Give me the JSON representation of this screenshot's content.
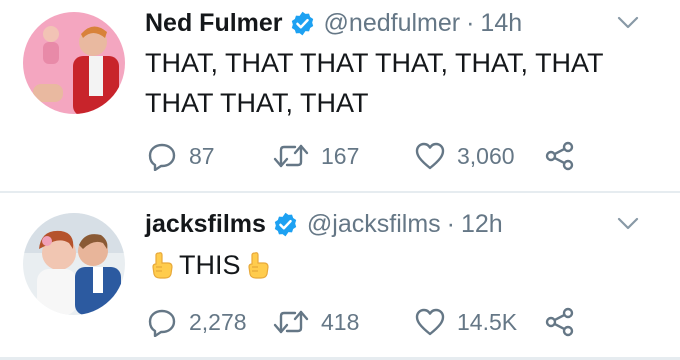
{
  "tweets": [
    {
      "display_name": "Ned Fulmer",
      "handle": "@nedfulmer",
      "separator": "·",
      "time": "14h",
      "text": "THAT, THAT THAT THAT, THAT, THAT THAT THAT, THAT",
      "replies": "87",
      "retweets": "167",
      "likes": "3,060"
    },
    {
      "display_name": "jacksfilms",
      "handle": "@jacksfilms",
      "separator": "·",
      "time": "12h",
      "text": "THIS",
      "text_emoji": "point-up-emoji",
      "replies": "2,278",
      "retweets": "418",
      "likes": "14.5K"
    }
  ],
  "colors": {
    "text": "#14171a",
    "secondary": "#657786",
    "verified": "#1da1f2",
    "divider": "#e6ecf0"
  },
  "icons": [
    "verified-badge-icon",
    "chevron-down-icon",
    "reply-icon",
    "retweet-icon",
    "like-icon",
    "share-icon",
    "point-up-emoji"
  ]
}
